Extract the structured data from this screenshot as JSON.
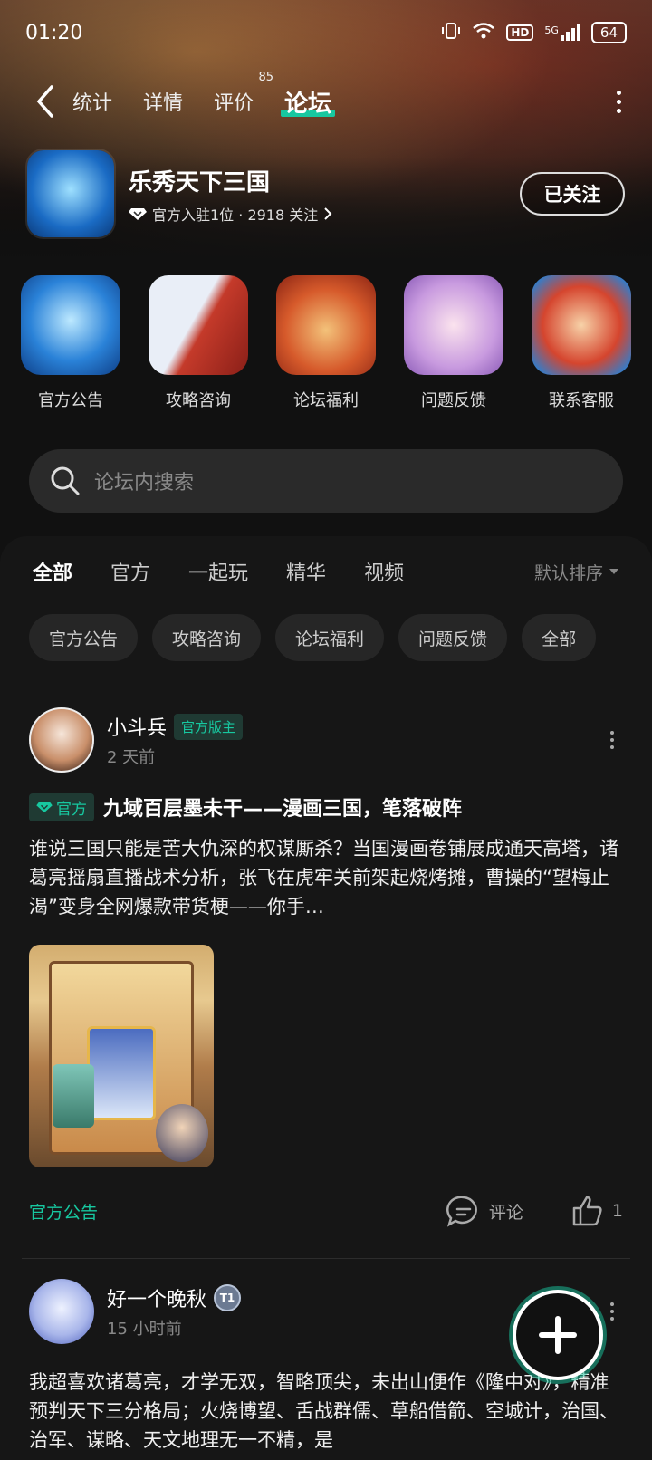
{
  "status": {
    "time": "01:20",
    "network": "5G",
    "hd": "HD",
    "battery": "64"
  },
  "nav": {
    "tabs": [
      {
        "label": "统计"
      },
      {
        "label": "详情"
      },
      {
        "label": "评价",
        "badge": "85"
      },
      {
        "label": "论坛",
        "active": true
      }
    ]
  },
  "game": {
    "title": "乐秀天下三国",
    "meta": "官方入驻1位 · 2918 关注",
    "follow_label": "已关注"
  },
  "quick": [
    {
      "label": "官方公告"
    },
    {
      "label": "攻略咨询"
    },
    {
      "label": "论坛福利"
    },
    {
      "label": "问题反馈"
    },
    {
      "label": "联系客服"
    }
  ],
  "search": {
    "placeholder": "论坛内搜索"
  },
  "feed": {
    "tabs": [
      "全部",
      "官方",
      "一起玩",
      "精华",
      "视频"
    ],
    "sort_label": "默认排序",
    "chips": [
      "官方公告",
      "攻略咨询",
      "论坛福利",
      "问题反馈",
      "全部"
    ]
  },
  "posts": [
    {
      "author": "小斗兵",
      "badge": "官方版主",
      "time": "2 天前",
      "tag": "官方",
      "title": "九域百层墨未干——漫画三国，笔落破阵",
      "body": "谁说三国只能是苦大仇深的权谋厮杀？当国漫画卷铺展成通天高塔，诸葛亮摇扇直播战术分析，张飞在虎牢关前架起烧烤摊，曹操的“望梅止渴”变身全网爆款带货梗——你手…",
      "category": "官方公告",
      "comment_label": "评论",
      "likes": "1"
    },
    {
      "author": "好一个晚秋",
      "level": "T1",
      "time": "15 小时前",
      "body": "我超喜欢诸葛亮，才学无双，智略顶尖，未出山便作《隆中对》，精准预判天下三分格局；火烧博望、舌战群儒、草船借箭、空城计，治国、治军、谋略、天文地理无一不精，是"
    }
  ],
  "colors": {
    "accent": "#17c8a0",
    "background": "#111111",
    "panel": "#161616"
  }
}
